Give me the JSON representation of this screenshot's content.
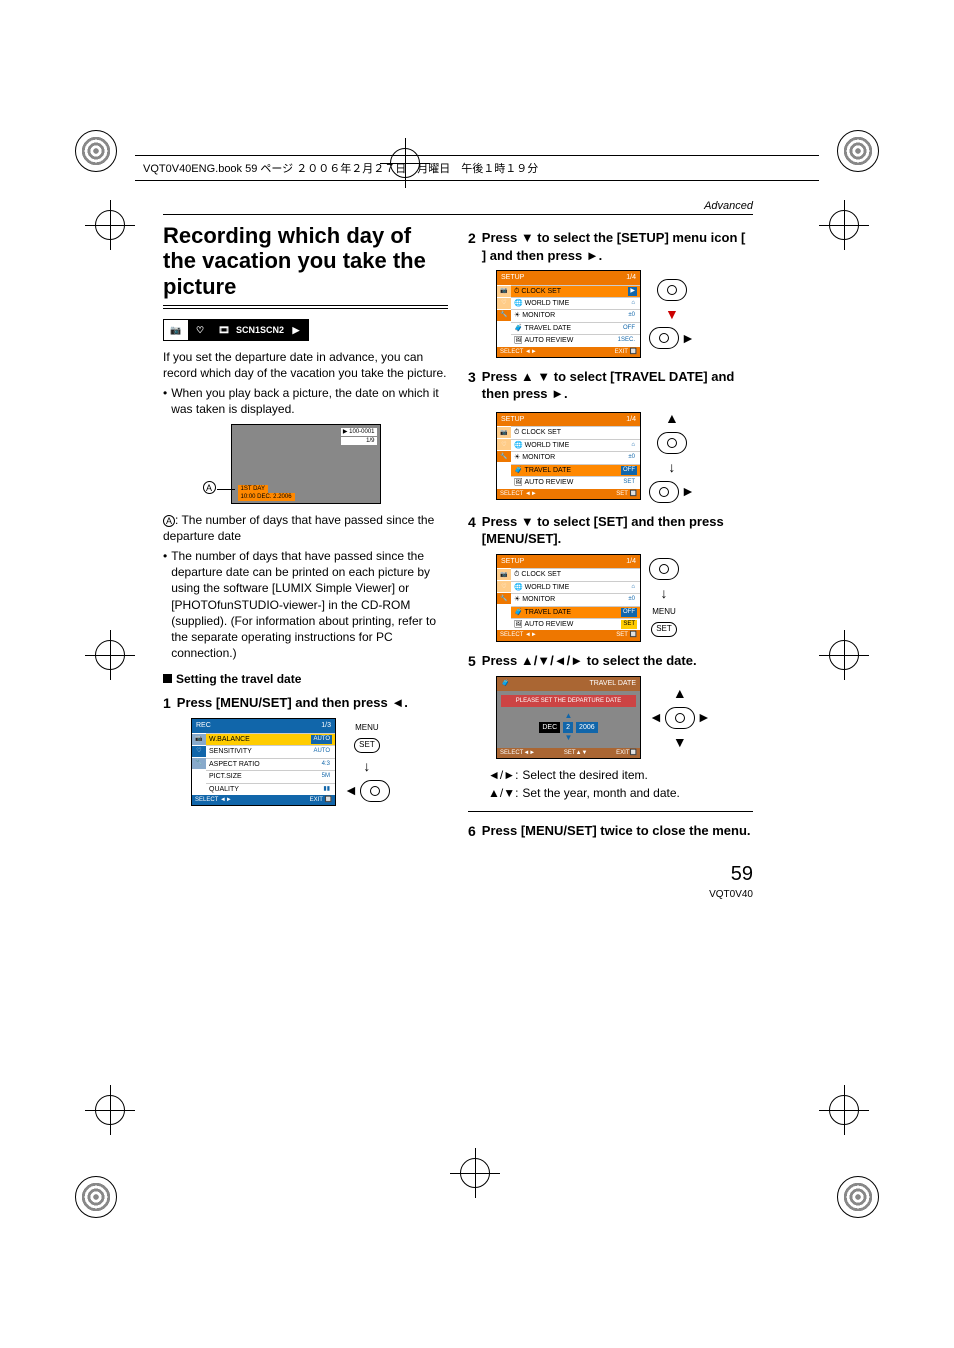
{
  "header": "VQT0V40ENG.book  59 ページ  ２００６年２月２７日　月曜日　午後１時１９分",
  "section_label": "Advanced",
  "title": "Recording which day of the vacation you take the picture",
  "mode_icons": [
    "📷",
    "♡",
    "🎞",
    "SCN1",
    "SCN2",
    "▶"
  ],
  "intro": "If you set the departure date in advance, you can record which day of the vacation you take the picture.",
  "intro_bullet": "When you play back a picture, the date on which it was taken is displayed.",
  "lcd": {
    "top1": "1ST DAY",
    "top2": "10:00  DEC. 2.2006",
    "tr1": "100-0001",
    "tr2": "1/9"
  },
  "caption_a": ": The number of days that have passed since the departure date",
  "bullet2": "The number of days that have passed since the departure date can be printed on each picture by using the software [LUMIX Simple Viewer] or [PHOTOfunSTUDIO-viewer-] in the CD-ROM (supplied). (For information about printing, refer to the separate operating instructions for PC connection.)",
  "subheading": "Setting the travel date",
  "step1": "Press [MENU/SET] and then press ◄.",
  "rec_menu": {
    "title": "REC",
    "page": "1/3",
    "rows": [
      {
        "l": "W.BALANCE",
        "v": "AUTO"
      },
      {
        "l": "SENSITIVITY",
        "v": "AUTO"
      },
      {
        "l": "ASPECT RATIO",
        "v": "4:3"
      },
      {
        "l": "PICT.SIZE",
        "v": "5M"
      },
      {
        "l": "QUALITY",
        "v": "▮▮"
      }
    ],
    "footer_l": "SELECT",
    "footer_r": "EXIT"
  },
  "ctrl_menu": "MENU",
  "ctrl_set": "SET",
  "step2": "Press ▼ to select the [SETUP] menu icon [ ] and then press ►.",
  "setup_menu": {
    "title": "SETUP",
    "page": "1/4",
    "rows": [
      {
        "l": "CLOCK SET",
        "v": ""
      },
      {
        "l": "WORLD TIME",
        "v": "⌂"
      },
      {
        "l": "MONITOR",
        "v": "±0"
      },
      {
        "l": "TRAVEL DATE",
        "v": "OFF"
      },
      {
        "l": "AUTO REVIEW",
        "v": "1SEC."
      }
    ],
    "footer_l": "SELECT",
    "footer_r": "EXIT"
  },
  "step3": "Press ▲ ▼ to select [TRAVEL DATE] and then press ►.",
  "setup_menu3": {
    "rows": [
      {
        "l": "CLOCK SET",
        "v": ""
      },
      {
        "l": "WORLD TIME",
        "v": "⌂"
      },
      {
        "l": "MONITOR",
        "v": "±0"
      },
      {
        "l": "TRAVEL DATE",
        "v": "OFF"
      },
      {
        "l": "AUTO REVIEW",
        "v": "SET"
      }
    ],
    "footer_l": "SELECT",
    "footer_m": "SET"
  },
  "step4": "Press ▼ to select [SET] and then press [MENU/SET].",
  "setup_menu4": {
    "rows": [
      {
        "l": "CLOCK SET",
        "v": ""
      },
      {
        "l": "WORLD TIME",
        "v": "⌂"
      },
      {
        "l": "MONITOR",
        "v": "±0"
      },
      {
        "l": "TRAVEL DATE",
        "v": "OFF"
      },
      {
        "l": "AUTO REVIEW",
        "v": "SET"
      }
    ]
  },
  "step5": "Press ▲/▼/◄/► to select the date.",
  "date_menu": {
    "title": "TRAVEL DATE",
    "msg": "PLEASE SET THE DEPARTURE DATE",
    "m": "DEC",
    "d": "2",
    "y": "2006",
    "footer_l": "SELECT",
    "footer_m": "SET",
    "footer_r": "EXIT"
  },
  "expl1_k": "◄/►:",
  "expl1_v": "Select the desired item.",
  "expl2_k": "▲/▼:",
  "expl2_v": "Set the year, month and date.",
  "step6": "Press [MENU/SET] twice to close the menu.",
  "page_number": "59",
  "doc_code": "VQT0V40"
}
